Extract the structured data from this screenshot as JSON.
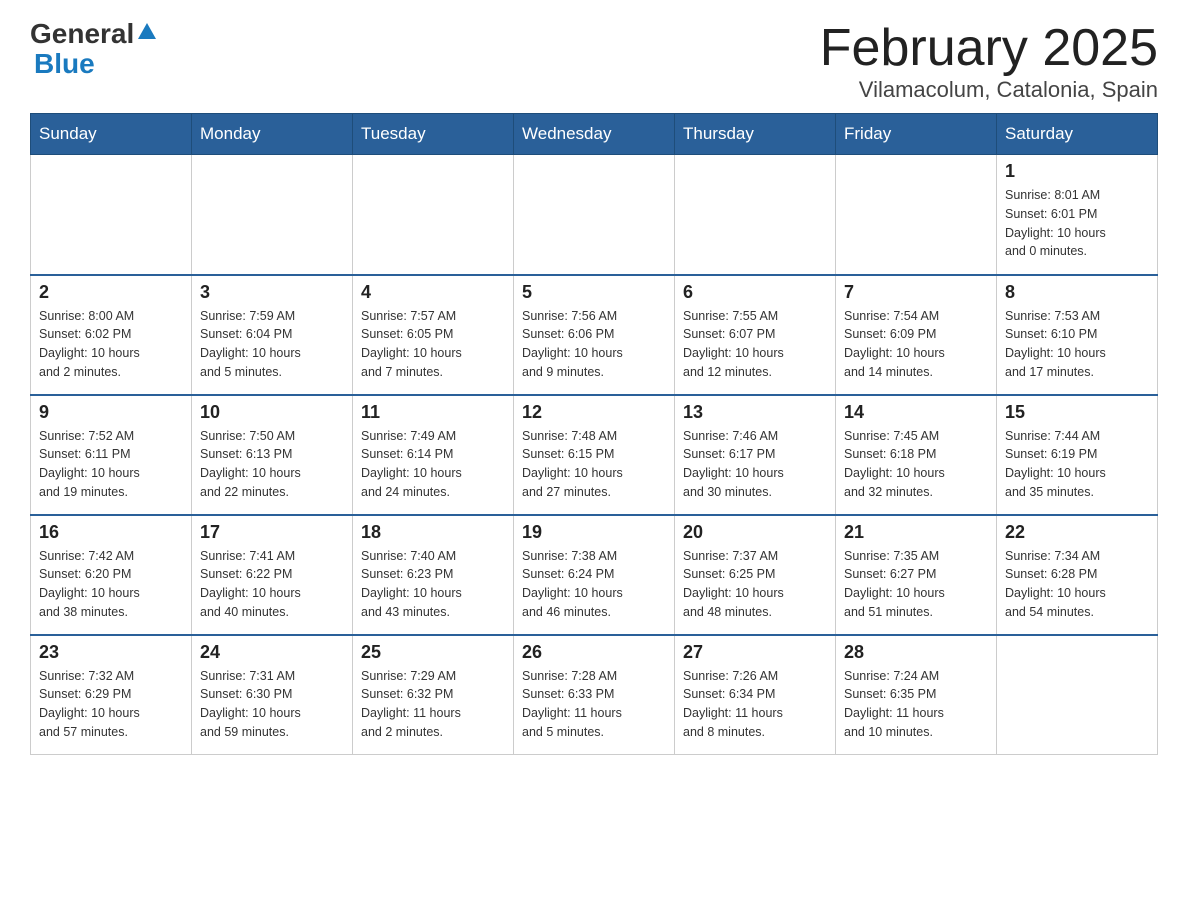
{
  "header": {
    "logo_general": "General",
    "logo_blue": "Blue",
    "month_title": "February 2025",
    "location": "Vilamacolum, Catalonia, Spain"
  },
  "weekdays": [
    "Sunday",
    "Monday",
    "Tuesday",
    "Wednesday",
    "Thursday",
    "Friday",
    "Saturday"
  ],
  "weeks": [
    [
      {
        "day": "",
        "info": ""
      },
      {
        "day": "",
        "info": ""
      },
      {
        "day": "",
        "info": ""
      },
      {
        "day": "",
        "info": ""
      },
      {
        "day": "",
        "info": ""
      },
      {
        "day": "",
        "info": ""
      },
      {
        "day": "1",
        "info": "Sunrise: 8:01 AM\nSunset: 6:01 PM\nDaylight: 10 hours\nand 0 minutes."
      }
    ],
    [
      {
        "day": "2",
        "info": "Sunrise: 8:00 AM\nSunset: 6:02 PM\nDaylight: 10 hours\nand 2 minutes."
      },
      {
        "day": "3",
        "info": "Sunrise: 7:59 AM\nSunset: 6:04 PM\nDaylight: 10 hours\nand 5 minutes."
      },
      {
        "day": "4",
        "info": "Sunrise: 7:57 AM\nSunset: 6:05 PM\nDaylight: 10 hours\nand 7 minutes."
      },
      {
        "day": "5",
        "info": "Sunrise: 7:56 AM\nSunset: 6:06 PM\nDaylight: 10 hours\nand 9 minutes."
      },
      {
        "day": "6",
        "info": "Sunrise: 7:55 AM\nSunset: 6:07 PM\nDaylight: 10 hours\nand 12 minutes."
      },
      {
        "day": "7",
        "info": "Sunrise: 7:54 AM\nSunset: 6:09 PM\nDaylight: 10 hours\nand 14 minutes."
      },
      {
        "day": "8",
        "info": "Sunrise: 7:53 AM\nSunset: 6:10 PM\nDaylight: 10 hours\nand 17 minutes."
      }
    ],
    [
      {
        "day": "9",
        "info": "Sunrise: 7:52 AM\nSunset: 6:11 PM\nDaylight: 10 hours\nand 19 minutes."
      },
      {
        "day": "10",
        "info": "Sunrise: 7:50 AM\nSunset: 6:13 PM\nDaylight: 10 hours\nand 22 minutes."
      },
      {
        "day": "11",
        "info": "Sunrise: 7:49 AM\nSunset: 6:14 PM\nDaylight: 10 hours\nand 24 minutes."
      },
      {
        "day": "12",
        "info": "Sunrise: 7:48 AM\nSunset: 6:15 PM\nDaylight: 10 hours\nand 27 minutes."
      },
      {
        "day": "13",
        "info": "Sunrise: 7:46 AM\nSunset: 6:17 PM\nDaylight: 10 hours\nand 30 minutes."
      },
      {
        "day": "14",
        "info": "Sunrise: 7:45 AM\nSunset: 6:18 PM\nDaylight: 10 hours\nand 32 minutes."
      },
      {
        "day": "15",
        "info": "Sunrise: 7:44 AM\nSunset: 6:19 PM\nDaylight: 10 hours\nand 35 minutes."
      }
    ],
    [
      {
        "day": "16",
        "info": "Sunrise: 7:42 AM\nSunset: 6:20 PM\nDaylight: 10 hours\nand 38 minutes."
      },
      {
        "day": "17",
        "info": "Sunrise: 7:41 AM\nSunset: 6:22 PM\nDaylight: 10 hours\nand 40 minutes."
      },
      {
        "day": "18",
        "info": "Sunrise: 7:40 AM\nSunset: 6:23 PM\nDaylight: 10 hours\nand 43 minutes."
      },
      {
        "day": "19",
        "info": "Sunrise: 7:38 AM\nSunset: 6:24 PM\nDaylight: 10 hours\nand 46 minutes."
      },
      {
        "day": "20",
        "info": "Sunrise: 7:37 AM\nSunset: 6:25 PM\nDaylight: 10 hours\nand 48 minutes."
      },
      {
        "day": "21",
        "info": "Sunrise: 7:35 AM\nSunset: 6:27 PM\nDaylight: 10 hours\nand 51 minutes."
      },
      {
        "day": "22",
        "info": "Sunrise: 7:34 AM\nSunset: 6:28 PM\nDaylight: 10 hours\nand 54 minutes."
      }
    ],
    [
      {
        "day": "23",
        "info": "Sunrise: 7:32 AM\nSunset: 6:29 PM\nDaylight: 10 hours\nand 57 minutes."
      },
      {
        "day": "24",
        "info": "Sunrise: 7:31 AM\nSunset: 6:30 PM\nDaylight: 10 hours\nand 59 minutes."
      },
      {
        "day": "25",
        "info": "Sunrise: 7:29 AM\nSunset: 6:32 PM\nDaylight: 11 hours\nand 2 minutes."
      },
      {
        "day": "26",
        "info": "Sunrise: 7:28 AM\nSunset: 6:33 PM\nDaylight: 11 hours\nand 5 minutes."
      },
      {
        "day": "27",
        "info": "Sunrise: 7:26 AM\nSunset: 6:34 PM\nDaylight: 11 hours\nand 8 minutes."
      },
      {
        "day": "28",
        "info": "Sunrise: 7:24 AM\nSunset: 6:35 PM\nDaylight: 11 hours\nand 10 minutes."
      },
      {
        "day": "",
        "info": ""
      }
    ]
  ]
}
